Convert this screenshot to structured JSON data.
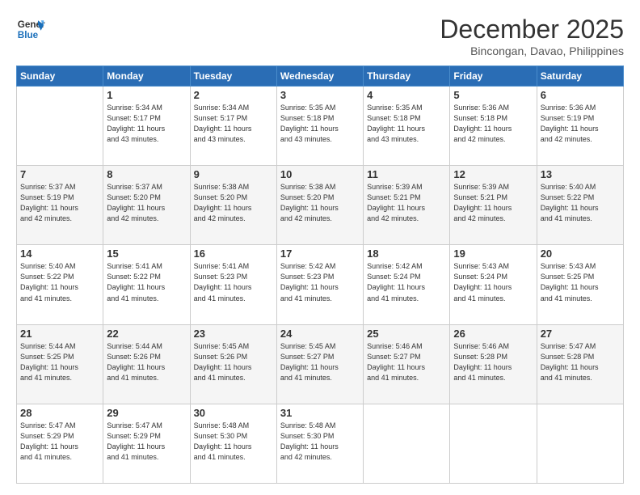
{
  "header": {
    "logo_line1": "General",
    "logo_line2": "Blue",
    "title": "December 2025",
    "subtitle": "Bincongan, Davao, Philippines"
  },
  "weekdays": [
    "Sunday",
    "Monday",
    "Tuesday",
    "Wednesday",
    "Thursday",
    "Friday",
    "Saturday"
  ],
  "weeks": [
    [
      {
        "day": "",
        "info": ""
      },
      {
        "day": "1",
        "info": "Sunrise: 5:34 AM\nSunset: 5:17 PM\nDaylight: 11 hours\nand 43 minutes."
      },
      {
        "day": "2",
        "info": "Sunrise: 5:34 AM\nSunset: 5:17 PM\nDaylight: 11 hours\nand 43 minutes."
      },
      {
        "day": "3",
        "info": "Sunrise: 5:35 AM\nSunset: 5:18 PM\nDaylight: 11 hours\nand 43 minutes."
      },
      {
        "day": "4",
        "info": "Sunrise: 5:35 AM\nSunset: 5:18 PM\nDaylight: 11 hours\nand 43 minutes."
      },
      {
        "day": "5",
        "info": "Sunrise: 5:36 AM\nSunset: 5:18 PM\nDaylight: 11 hours\nand 42 minutes."
      },
      {
        "day": "6",
        "info": "Sunrise: 5:36 AM\nSunset: 5:19 PM\nDaylight: 11 hours\nand 42 minutes."
      }
    ],
    [
      {
        "day": "7",
        "info": "Sunrise: 5:37 AM\nSunset: 5:19 PM\nDaylight: 11 hours\nand 42 minutes."
      },
      {
        "day": "8",
        "info": "Sunrise: 5:37 AM\nSunset: 5:20 PM\nDaylight: 11 hours\nand 42 minutes."
      },
      {
        "day": "9",
        "info": "Sunrise: 5:38 AM\nSunset: 5:20 PM\nDaylight: 11 hours\nand 42 minutes."
      },
      {
        "day": "10",
        "info": "Sunrise: 5:38 AM\nSunset: 5:20 PM\nDaylight: 11 hours\nand 42 minutes."
      },
      {
        "day": "11",
        "info": "Sunrise: 5:39 AM\nSunset: 5:21 PM\nDaylight: 11 hours\nand 42 minutes."
      },
      {
        "day": "12",
        "info": "Sunrise: 5:39 AM\nSunset: 5:21 PM\nDaylight: 11 hours\nand 42 minutes."
      },
      {
        "day": "13",
        "info": "Sunrise: 5:40 AM\nSunset: 5:22 PM\nDaylight: 11 hours\nand 41 minutes."
      }
    ],
    [
      {
        "day": "14",
        "info": "Sunrise: 5:40 AM\nSunset: 5:22 PM\nDaylight: 11 hours\nand 41 minutes."
      },
      {
        "day": "15",
        "info": "Sunrise: 5:41 AM\nSunset: 5:22 PM\nDaylight: 11 hours\nand 41 minutes."
      },
      {
        "day": "16",
        "info": "Sunrise: 5:41 AM\nSunset: 5:23 PM\nDaylight: 11 hours\nand 41 minutes."
      },
      {
        "day": "17",
        "info": "Sunrise: 5:42 AM\nSunset: 5:23 PM\nDaylight: 11 hours\nand 41 minutes."
      },
      {
        "day": "18",
        "info": "Sunrise: 5:42 AM\nSunset: 5:24 PM\nDaylight: 11 hours\nand 41 minutes."
      },
      {
        "day": "19",
        "info": "Sunrise: 5:43 AM\nSunset: 5:24 PM\nDaylight: 11 hours\nand 41 minutes."
      },
      {
        "day": "20",
        "info": "Sunrise: 5:43 AM\nSunset: 5:25 PM\nDaylight: 11 hours\nand 41 minutes."
      }
    ],
    [
      {
        "day": "21",
        "info": "Sunrise: 5:44 AM\nSunset: 5:25 PM\nDaylight: 11 hours\nand 41 minutes."
      },
      {
        "day": "22",
        "info": "Sunrise: 5:44 AM\nSunset: 5:26 PM\nDaylight: 11 hours\nand 41 minutes."
      },
      {
        "day": "23",
        "info": "Sunrise: 5:45 AM\nSunset: 5:26 PM\nDaylight: 11 hours\nand 41 minutes."
      },
      {
        "day": "24",
        "info": "Sunrise: 5:45 AM\nSunset: 5:27 PM\nDaylight: 11 hours\nand 41 minutes."
      },
      {
        "day": "25",
        "info": "Sunrise: 5:46 AM\nSunset: 5:27 PM\nDaylight: 11 hours\nand 41 minutes."
      },
      {
        "day": "26",
        "info": "Sunrise: 5:46 AM\nSunset: 5:28 PM\nDaylight: 11 hours\nand 41 minutes."
      },
      {
        "day": "27",
        "info": "Sunrise: 5:47 AM\nSunset: 5:28 PM\nDaylight: 11 hours\nand 41 minutes."
      }
    ],
    [
      {
        "day": "28",
        "info": "Sunrise: 5:47 AM\nSunset: 5:29 PM\nDaylight: 11 hours\nand 41 minutes."
      },
      {
        "day": "29",
        "info": "Sunrise: 5:47 AM\nSunset: 5:29 PM\nDaylight: 11 hours\nand 41 minutes."
      },
      {
        "day": "30",
        "info": "Sunrise: 5:48 AM\nSunset: 5:30 PM\nDaylight: 11 hours\nand 41 minutes."
      },
      {
        "day": "31",
        "info": "Sunrise: 5:48 AM\nSunset: 5:30 PM\nDaylight: 11 hours\nand 42 minutes."
      },
      {
        "day": "",
        "info": ""
      },
      {
        "day": "",
        "info": ""
      },
      {
        "day": "",
        "info": ""
      }
    ]
  ]
}
